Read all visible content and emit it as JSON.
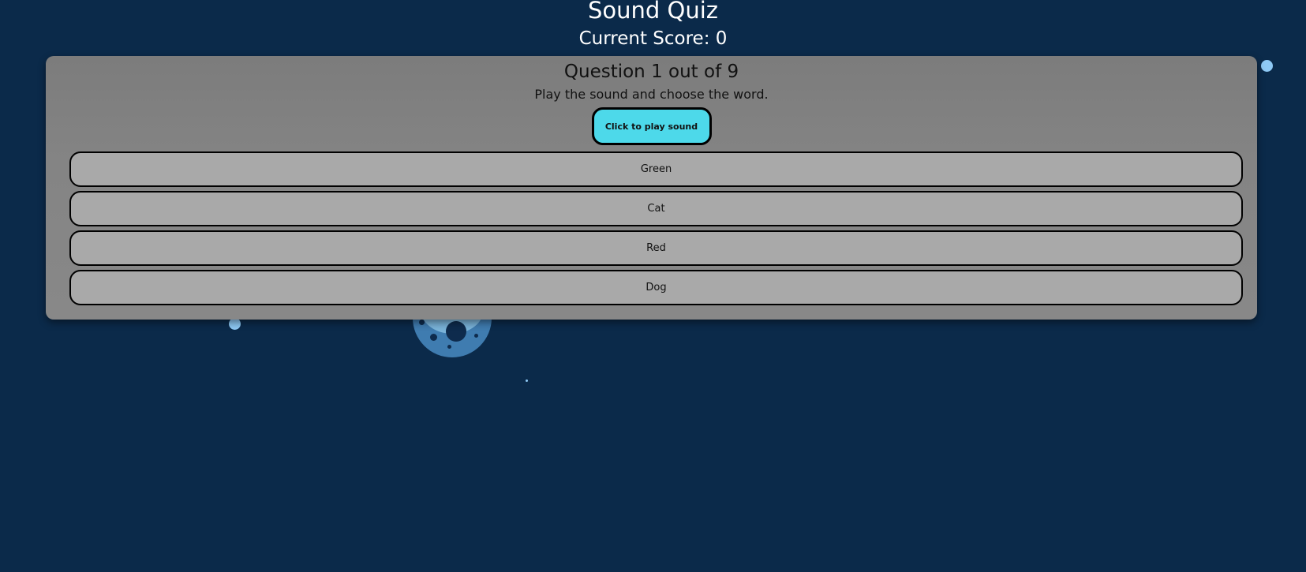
{
  "header": {
    "title": "Sound Quiz",
    "score_label": "Current Score: 0"
  },
  "quiz": {
    "question_label": "Question 1 out of 9",
    "instructions": "Play the sound and choose the word.",
    "play_button_label": "Click to play sound",
    "options": [
      "Green",
      "Cat",
      "Red",
      "Dog"
    ]
  },
  "colors": {
    "background": "#0b2a4a",
    "panel": "#828282",
    "play_button": "#4dd9ea",
    "option": "#a9a9a9"
  }
}
